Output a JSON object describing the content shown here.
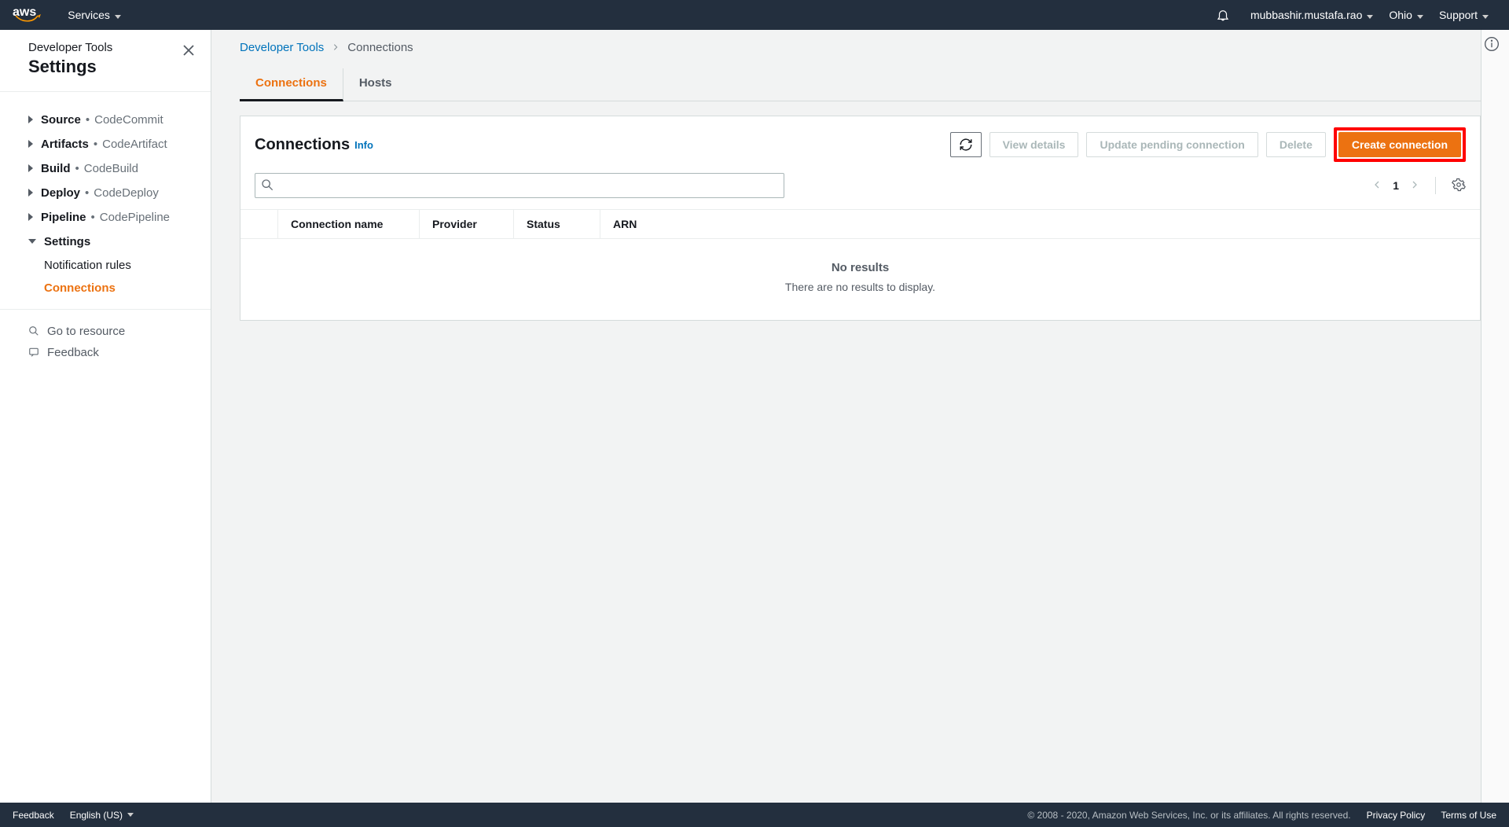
{
  "topnav": {
    "services": "Services",
    "user": "mubbashir.mustafa.rao",
    "region": "Ohio",
    "support": "Support"
  },
  "sidebar": {
    "subtitle": "Developer Tools",
    "title": "Settings",
    "groups": [
      {
        "label": "Source",
        "sub": "CodeCommit",
        "expanded": false
      },
      {
        "label": "Artifacts",
        "sub": "CodeArtifact",
        "expanded": false
      },
      {
        "label": "Build",
        "sub": "CodeBuild",
        "expanded": false
      },
      {
        "label": "Deploy",
        "sub": "CodeDeploy",
        "expanded": false
      },
      {
        "label": "Pipeline",
        "sub": "CodePipeline",
        "expanded": false
      },
      {
        "label": "Settings",
        "expanded": true,
        "children": [
          {
            "label": "Notification rules",
            "active": false
          },
          {
            "label": "Connections",
            "active": true
          }
        ]
      }
    ],
    "goto": "Go to resource",
    "feedback": "Feedback"
  },
  "breadcrumb": {
    "root": "Developer Tools",
    "current": "Connections"
  },
  "tabs": {
    "connections": "Connections",
    "hosts": "Hosts",
    "active": "connections"
  },
  "panel": {
    "title": "Connections",
    "info": "Info",
    "buttons": {
      "view": "View details",
      "update": "Update pending connection",
      "delete": "Delete",
      "create": "Create connection"
    },
    "page": "1",
    "columns": {
      "name": "Connection name",
      "provider": "Provider",
      "status": "Status",
      "arn": "ARN"
    },
    "empty_title": "No results",
    "empty_sub": "There are no results to display."
  },
  "footer": {
    "feedback": "Feedback",
    "lang": "English (US)",
    "copy": "© 2008 - 2020, Amazon Web Services, Inc. or its affiliates. All rights reserved.",
    "privacy": "Privacy Policy",
    "terms": "Terms of Use"
  }
}
